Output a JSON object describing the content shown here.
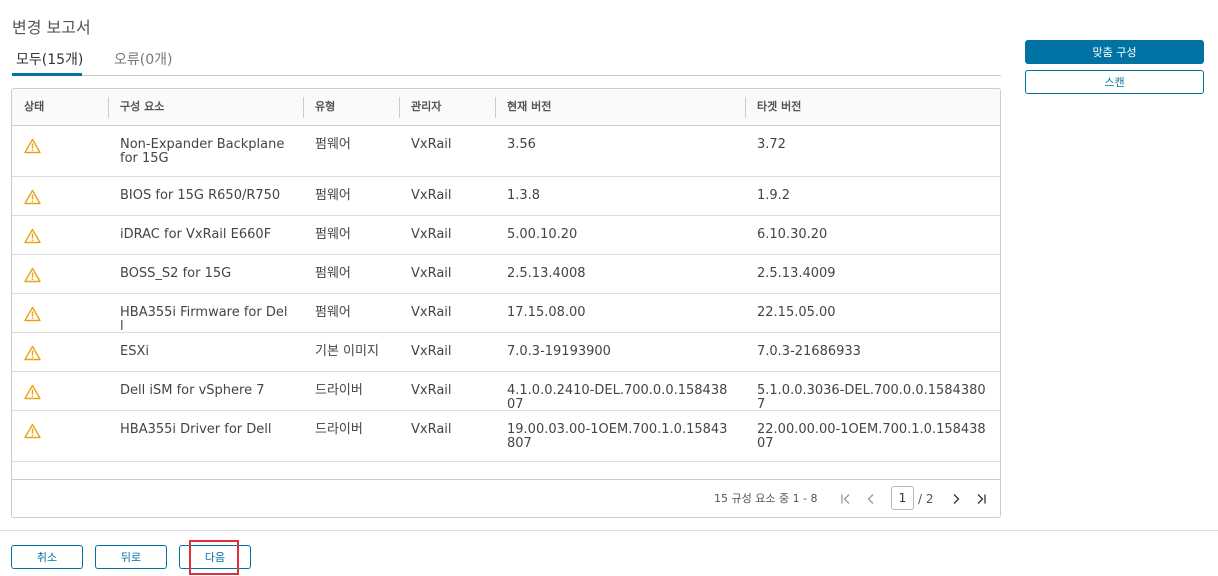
{
  "page": {
    "title": "변경 보고서"
  },
  "tabs": [
    {
      "label": "모두(15개)",
      "active": true
    },
    {
      "label": "오류(0개)",
      "active": false
    }
  ],
  "actions": {
    "apply_label": "맞춤 구성",
    "scan_label": "스캔"
  },
  "table": {
    "columns": [
      "상태",
      "구성 요소",
      "유형",
      "관리자",
      "현재 버전",
      "타겟 버전"
    ],
    "rows": [
      {
        "status": "warning-icon",
        "component": "Non-Expander Backplane for 15G",
        "type": "펌웨어",
        "manager": "VxRail",
        "current": "3.56",
        "target": "3.72"
      },
      {
        "status": "warning-icon",
        "component": "BIOS for 15G R650/R750",
        "type": "펌웨어",
        "manager": "VxRail",
        "current": "1.3.8",
        "target": "1.9.2"
      },
      {
        "status": "warning-icon",
        "component": "iDRAC for VxRail E660F",
        "type": "펌웨어",
        "manager": "VxRail",
        "current": "5.00.10.20",
        "target": "6.10.30.20"
      },
      {
        "status": "warning-icon",
        "component": "BOSS_S2 for 15G",
        "type": "펌웨어",
        "manager": "VxRail",
        "current": "2.5.13.4008",
        "target": "2.5.13.4009"
      },
      {
        "status": "warning-icon",
        "component": "HBA355i Firmware for Dell",
        "type": "펌웨어",
        "manager": "VxRail",
        "current": "17.15.08.00",
        "target": "22.15.05.00"
      },
      {
        "status": "warning-icon",
        "component": "ESXi",
        "type": "기본 이미지",
        "manager": "VxRail",
        "current": "7.0.3-19193900",
        "target": "7.0.3-21686933"
      },
      {
        "status": "warning-icon",
        "component": "Dell iSM for vSphere 7",
        "type": "드라이버",
        "manager": "VxRail",
        "current": "4.1.0.0.2410-DEL.700.0.0.15843807",
        "target": "5.1.0.0.3036-DEL.700.0.0.15843807"
      },
      {
        "status": "warning-icon",
        "component": "HBA355i Driver for Dell",
        "type": "드라이버",
        "manager": "VxRail",
        "current": "19.00.03.00-1OEM.700.1.0.15843807",
        "target": "22.00.00.00-1OEM.700.1.0.15843807"
      }
    ]
  },
  "pagination": {
    "summary": "15 규성 요소 중 1 - 8",
    "current_page": "1",
    "total": "/ 2"
  },
  "footer": {
    "cancel_label": "취소",
    "back_label": "뒤로",
    "next_label": "다음"
  },
  "colors": {
    "accent": "#0072a3",
    "warning": "#e8a317",
    "highlight": "#e0303a"
  }
}
